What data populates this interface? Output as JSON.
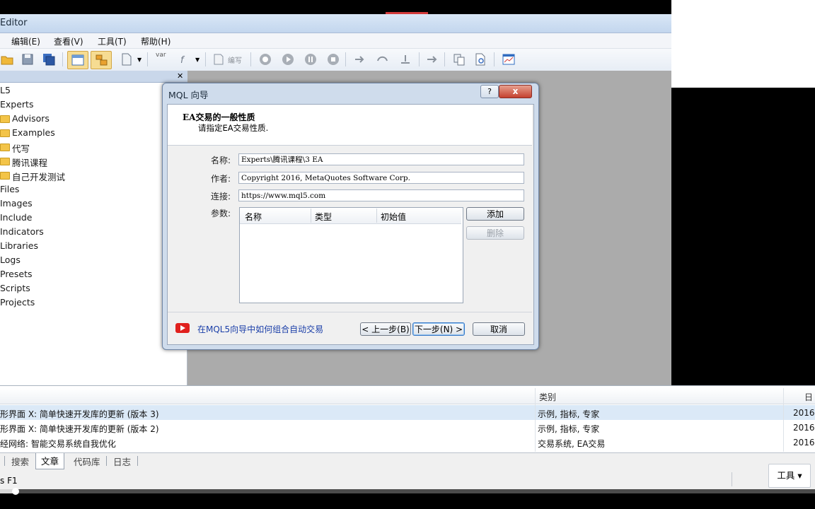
{
  "window": {
    "title": "Editor"
  },
  "menu": [
    "编辑(E)",
    "查看(V)",
    "工具(T)",
    "帮助(H)"
  ],
  "toolbar": {
    "var_label": "var",
    "compile_label": "编写"
  },
  "navigator": {
    "items": [
      "L5",
      "Experts",
      "Advisors",
      "Examples",
      "代写",
      "腾讯课程",
      "自己开发测试",
      "Files",
      "Images",
      "Include",
      "Indicators",
      "Libraries",
      "Logs",
      "Presets",
      "Scripts",
      "Projects"
    ]
  },
  "dialog": {
    "title": "MQL 向导",
    "help_label": "?",
    "close_label": "x",
    "heading": "EA交易的一般性质",
    "subheading": "请指定EA交易性质.",
    "fields": {
      "name_label": "名称:",
      "name_value": "Experts\\腾讯课程\\3 EA",
      "author_label": "作者:",
      "author_value": "Copyright 2016, MetaQuotes Software Corp.",
      "link_label": "连接:",
      "link_value": "https://www.mql5.com",
      "params_label": "参数:"
    },
    "params_table": {
      "columns": [
        "名称",
        "类型",
        "初始值"
      ],
      "rows": []
    },
    "buttons": {
      "add": "添加",
      "delete": "删除",
      "back": "< 上一步(B)",
      "next": "下一步(N) >",
      "cancel": "取消"
    },
    "help_link": "在MQL5向导中如何组合自动交易"
  },
  "articles": {
    "headers": {
      "category": "类别",
      "date": "日期"
    },
    "rows": [
      {
        "title": "形界面 X: 简单快速开发库的更新 (版本 3)",
        "category": "示例, 指标, 专家",
        "date": "2016.",
        "selected": true
      },
      {
        "title": "形界面 X: 简单快速开发库的更新 (版本 2)",
        "category": "示例, 指标, 专家",
        "date": "2016.",
        "selected": false
      },
      {
        "title": "经网络: 智能交易系统自我优化",
        "category": "交易系统, EA交易",
        "date": "2016.",
        "selected": false
      }
    ]
  },
  "bottom_tabs": [
    "搜索",
    "文章",
    "代码库",
    "日志"
  ],
  "active_tab": "文章",
  "tools_button": "工具 ▾",
  "status": {
    "text": "s F1"
  },
  "video": {
    "progress": 0.02
  },
  "colors": {
    "accent": "#3b7bc7",
    "close_red": "#c4412f",
    "workspace": "#ababab",
    "link": "#1a3ea8"
  }
}
